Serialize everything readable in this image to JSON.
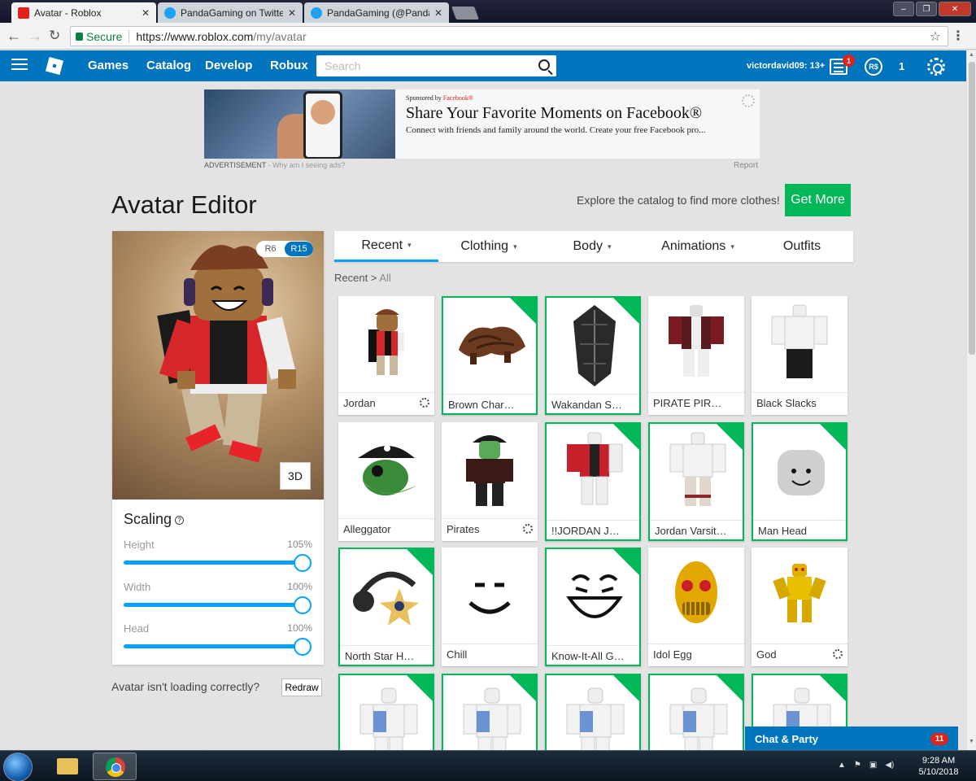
{
  "browser": {
    "tabs": [
      {
        "title": "Avatar - Roblox",
        "close": "✕"
      },
      {
        "title": "PandaGaming on Twitter",
        "close": "✕"
      },
      {
        "title": "PandaGaming (@PandaG",
        "close": "✕"
      }
    ],
    "secure_label": "Secure",
    "url_host": "https://www.roblox.com",
    "url_path": "/my/avatar"
  },
  "header": {
    "nav": [
      "Games",
      "Catalog",
      "Develop",
      "Robux"
    ],
    "search_placeholder": "Search",
    "username": "victordavid09: 13+",
    "notification_count": "1",
    "robux_symbol": "R$",
    "robux_balance": "1"
  },
  "ad": {
    "sponsor_prefix": "Sponsored by",
    "sponsor": "Facebook®",
    "title": "Share Your Favorite Moments on Facebook®",
    "description": "Connect with friends and family around the world. Create your free Facebook pro...",
    "label": "ADVERTISEMENT",
    "why": " - Why am I seeing ads?",
    "report": "Report"
  },
  "page": {
    "title": "Avatar Editor",
    "explore_text": "Explore the catalog to find more clothes!",
    "get_more": "Get More"
  },
  "avatar": {
    "rig_r6": "R6",
    "rig_r15": "R15",
    "rig_selected": "R15",
    "view_3d": "3D",
    "scaling_title": "Scaling",
    "help": "?",
    "scales": [
      {
        "label": "Height",
        "value": "105%",
        "fraction": 1.0
      },
      {
        "label": "Width",
        "value": "100%",
        "fraction": 1.0
      },
      {
        "label": "Head",
        "value": "100%",
        "fraction": 1.0
      }
    ],
    "loading_question": "Avatar isn't loading correctly?",
    "redraw": "Redraw"
  },
  "categories": {
    "tabs": [
      {
        "label": "Recent",
        "dropdown": true
      },
      {
        "label": "Clothing",
        "dropdown": true
      },
      {
        "label": "Body",
        "dropdown": true
      },
      {
        "label": "Animations",
        "dropdown": true
      },
      {
        "label": "Outfits",
        "dropdown": false
      }
    ],
    "active": "Recent",
    "breadcrumb_root": "Recent",
    "breadcrumb_sep": ">",
    "breadcrumb_leaf": "All"
  },
  "items": [
    {
      "name": "Jordan",
      "selected": false,
      "gear": true,
      "thumb": "avatar-figure"
    },
    {
      "name": "Brown Charmer...",
      "selected": true,
      "gear": false,
      "thumb": "brown-hair"
    },
    {
      "name": "Wakandan Shield",
      "selected": true,
      "gear": false,
      "thumb": "shield"
    },
    {
      "name": "PIRATE PIRATE ...",
      "selected": false,
      "gear": false,
      "thumb": "shirt-dark"
    },
    {
      "name": "Black Slacks",
      "selected": false,
      "gear": false,
      "thumb": "pants-black"
    },
    {
      "name": "Alleggator",
      "selected": false,
      "gear": false,
      "thumb": "gator-head"
    },
    {
      "name": "Pirates",
      "selected": false,
      "gear": true,
      "thumb": "pirate-figure"
    },
    {
      "name": "!!JORDAN JORD...",
      "selected": true,
      "gear": false,
      "thumb": "shirt-jordan"
    },
    {
      "name": "Jordan Varsity P...",
      "selected": true,
      "gear": false,
      "thumb": "pants-varsity"
    },
    {
      "name": "Man Head",
      "selected": true,
      "gear": false,
      "thumb": "head-gray"
    },
    {
      "name": "North Star Hea...",
      "selected": true,
      "gear": false,
      "thumb": "headphones-star"
    },
    {
      "name": "Chill",
      "selected": false,
      "gear": false,
      "thumb": "face-chill"
    },
    {
      "name": "Know-It-All Grin",
      "selected": true,
      "gear": false,
      "thumb": "face-grin"
    },
    {
      "name": "Idol Egg",
      "selected": false,
      "gear": false,
      "thumb": "gold-head"
    },
    {
      "name": "God",
      "selected": false,
      "gear": true,
      "thumb": "gold-figure"
    },
    {
      "name": "",
      "selected": true,
      "gear": false,
      "thumb": "white-torso-blue"
    },
    {
      "name": "",
      "selected": true,
      "gear": false,
      "thumb": "white-torso-blue"
    },
    {
      "name": "",
      "selected": true,
      "gear": false,
      "thumb": "white-torso-blue"
    },
    {
      "name": "",
      "selected": true,
      "gear": false,
      "thumb": "white-torso-blue"
    },
    {
      "name": "",
      "selected": true,
      "gear": false,
      "thumb": "white-torso-blue"
    }
  ],
  "chat": {
    "label": "Chat & Party",
    "count": "11"
  },
  "taskbar": {
    "time": "9:28 AM",
    "date": "5/10/2018"
  },
  "colors": {
    "roblox_blue": "#0074bd",
    "accent": "#00a2ff",
    "green": "#02b757",
    "badge_red": "#e2231a"
  }
}
